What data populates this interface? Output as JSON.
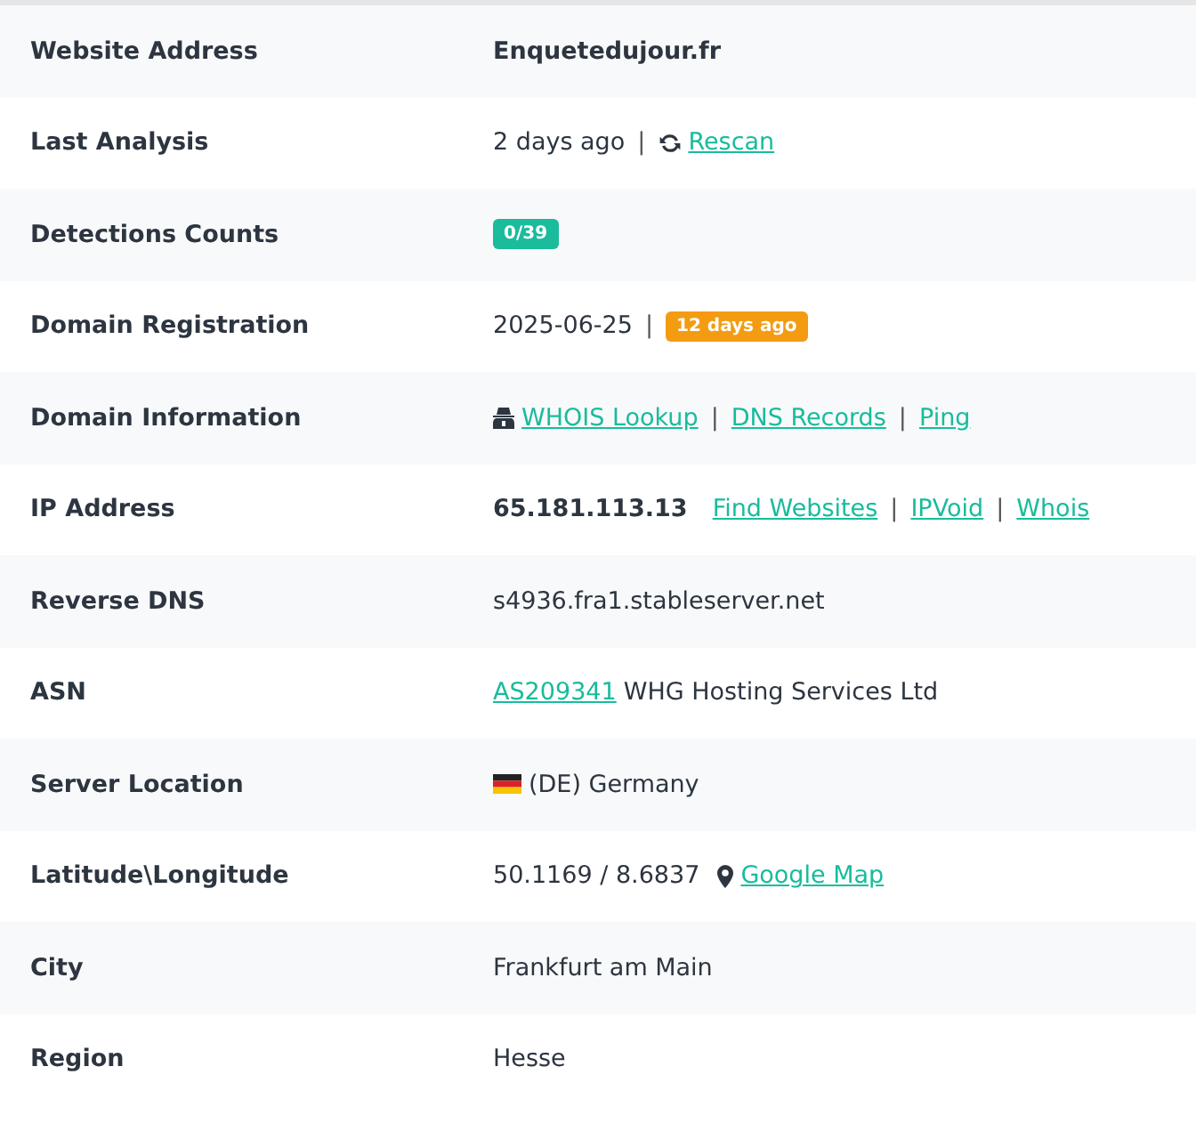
{
  "rows": [
    {
      "label": "Website Address",
      "parts": [
        {
          "kind": "strong",
          "text": "Enquetedujour.fr"
        }
      ]
    },
    {
      "label": "Last Analysis",
      "parts": [
        {
          "kind": "text",
          "text": "2 days ago"
        },
        {
          "kind": "separator",
          "text": "|"
        },
        {
          "kind": "refresh"
        },
        {
          "kind": "link",
          "text": "Rescan"
        }
      ]
    },
    {
      "label": "Detections Counts",
      "parts": [
        {
          "kind": "badge",
          "text": "0/39",
          "color": "#1abc9c"
        }
      ]
    },
    {
      "label": "Domain Registration",
      "parts": [
        {
          "kind": "text",
          "text": "2025-06-25"
        },
        {
          "kind": "separator",
          "text": "|"
        },
        {
          "kind": "badge",
          "text": "12 days ago",
          "color": "#f39c12"
        }
      ]
    },
    {
      "label": "Domain Information",
      "parts": [
        {
          "kind": "spy"
        },
        {
          "kind": "link",
          "text": "WHOIS Lookup"
        },
        {
          "kind": "separator",
          "text": "|"
        },
        {
          "kind": "link",
          "text": "DNS Records"
        },
        {
          "kind": "separator",
          "text": "|"
        },
        {
          "kind": "link",
          "text": "Ping"
        }
      ]
    },
    {
      "label": "IP Address",
      "parts": [
        {
          "kind": "strong",
          "text": "65.181.113.13"
        },
        {
          "kind": "link",
          "text": "Find Websites"
        },
        {
          "kind": "separator",
          "text": "|"
        },
        {
          "kind": "link",
          "text": "IPVoid"
        },
        {
          "kind": "separator",
          "text": "|"
        },
        {
          "kind": "link",
          "text": "Whois"
        }
      ]
    },
    {
      "label": "Reverse DNS",
      "parts": [
        {
          "kind": "text",
          "text": "s4936.fra1.stableserver.net"
        }
      ]
    },
    {
      "label": "ASN",
      "parts": [
        {
          "kind": "link",
          "text": "AS209341"
        },
        {
          "kind": "text",
          "text": "WHG Hosting Services Ltd"
        }
      ]
    },
    {
      "label": "Server Location",
      "parts": [
        {
          "kind": "flag"
        },
        {
          "kind": "text",
          "text": "(DE) Germany"
        }
      ]
    },
    {
      "label": "Latitude\\Longitude",
      "parts": [
        {
          "kind": "text",
          "text": "50.1169 / 8.6837"
        },
        {
          "kind": "pin"
        },
        {
          "kind": "link",
          "text": "Google Map"
        }
      ]
    },
    {
      "label": "City",
      "parts": [
        {
          "kind": "text",
          "text": "Frankfurt am Main"
        }
      ]
    },
    {
      "label": "Region",
      "parts": [
        {
          "kind": "text",
          "text": "Hesse"
        }
      ]
    }
  ]
}
